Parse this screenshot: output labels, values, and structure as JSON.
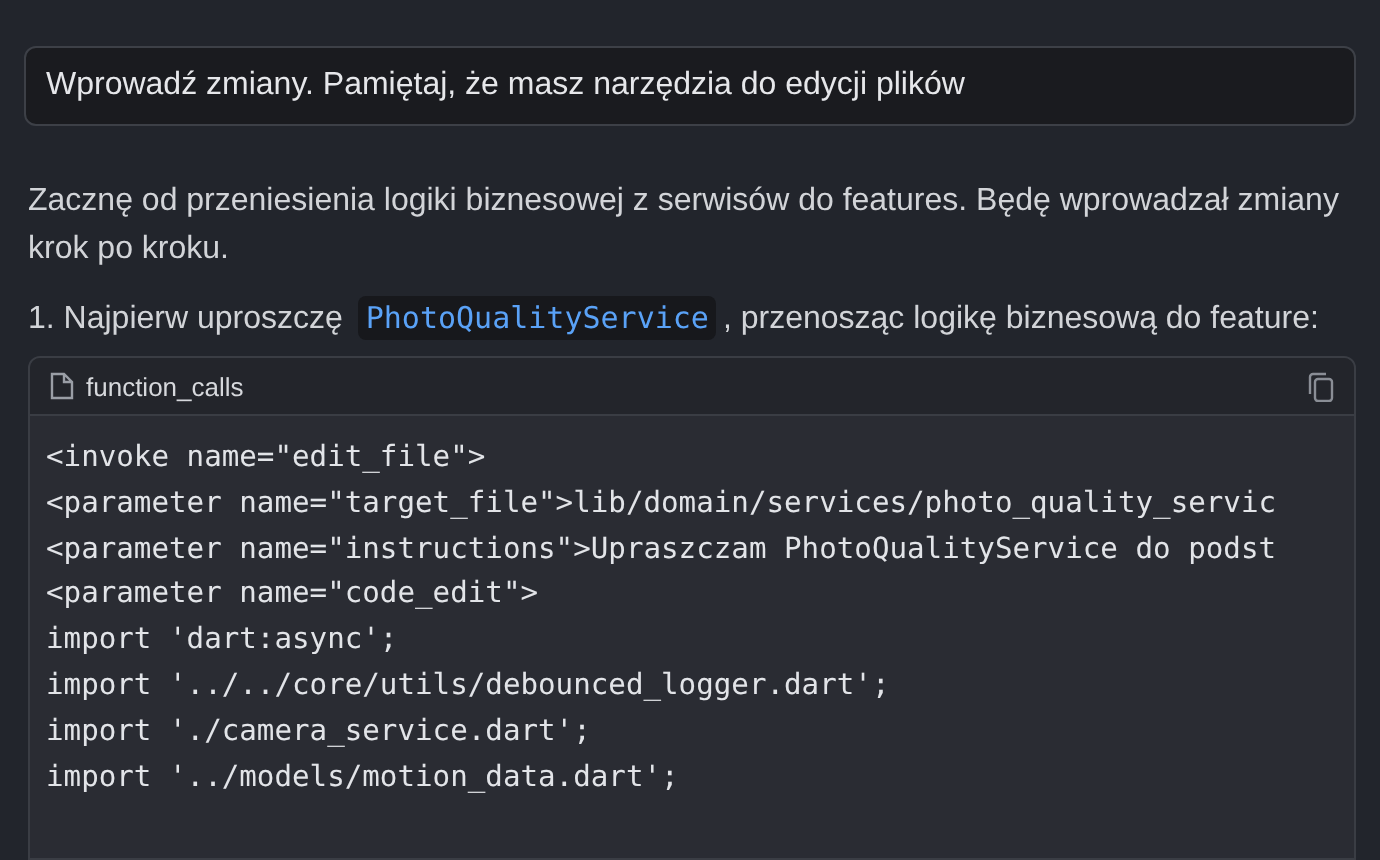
{
  "user_message": {
    "text": "Wprowadź zmiany. Pamiętaj, że masz narzędzia do edycji plików"
  },
  "reply": {
    "intro": "Zacznę od przeniesienia logiki biznesowej z serwisów do features. Będę wprowadzał zmiany krok po kroku.",
    "step": {
      "before": "1. Najpierw uproszczę",
      "code": "PhotoQualityService",
      "after": ", przenosząc logikę biznesową do feature:"
    }
  },
  "code_block": {
    "title": "function_calls",
    "lines": [
      "<invoke name=\"edit_file\">",
      "<parameter name=\"target_file\">lib/domain/services/photo_quality_servic",
      "<parameter name=\"instructions\">Upraszczam PhotoQualityService do podst",
      "<parameter name=\"code_edit\">",
      "import 'dart:async';",
      "import '../../core/utils/debounced_logger.dart';",
      "import './camera_service.dart';",
      "import '../models/motion_data.dart';"
    ]
  }
}
